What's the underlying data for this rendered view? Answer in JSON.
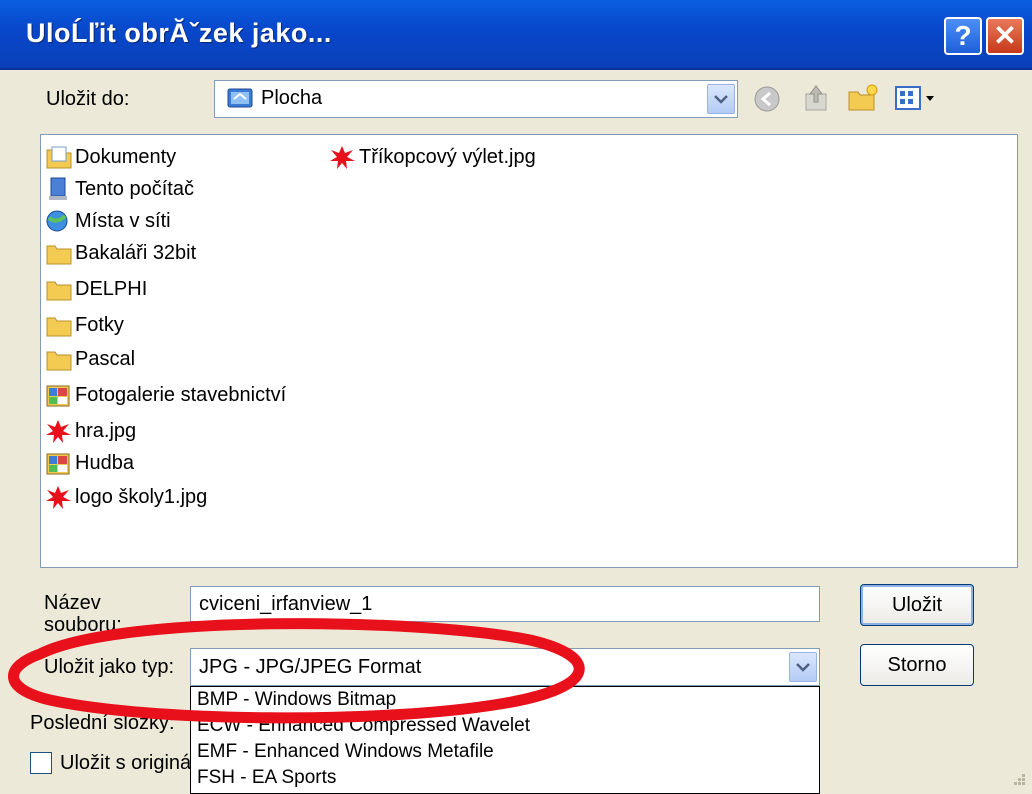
{
  "window": {
    "title": "UloĹľit obrĂˇzek jako...",
    "help_symbol": "?",
    "close_symbol": "✕"
  },
  "save_in": {
    "label": "Uložit do:",
    "value": "Plocha",
    "folder_icon": "desktop-icon"
  },
  "files": [
    {
      "name": "Dokumenty",
      "icon": "documents-folder-icon"
    },
    {
      "name": "Tento počítač",
      "icon": "my-computer-icon"
    },
    {
      "name": "Místa v síti",
      "icon": "network-places-icon"
    },
    {
      "name": "Bakaláři 32bit",
      "icon": "folder-icon"
    },
    {
      "name": "DELPHI",
      "icon": "folder-icon"
    },
    {
      "name": "Fotky",
      "icon": "folder-icon"
    },
    {
      "name": "Pascal",
      "icon": "folder-icon"
    },
    {
      "name": "Fotogalerie stavebnictví",
      "icon": "shortcut-icon"
    },
    {
      "name": "hra.jpg",
      "icon": "irfanview-image-icon"
    },
    {
      "name": "Hudba",
      "icon": "shortcut-icon"
    },
    {
      "name": "logo školy1.jpg",
      "icon": "irfanview-image-icon"
    },
    {
      "name": "Tříkopcový výlet.jpg",
      "icon": "irfanview-image-icon"
    }
  ],
  "filename": {
    "label": "Název souboru:",
    "value": "cviceni_irfanview_1"
  },
  "filetype": {
    "label": "Uložit jako typ:",
    "value": "JPG - JPG/JPEG Format",
    "options": [
      "BMP - Windows Bitmap",
      "ECW - Enhanced Compressed Wavelet",
      "EMF - Enhanced Windows Metafile",
      "FSH - EA Sports"
    ]
  },
  "recent_label": "Poslední složky:",
  "checkbox_label": "Uložit s originál",
  "buttons": {
    "save": "Uložit",
    "cancel": "Storno"
  },
  "colors": {
    "titlebar": "#0a5fe0",
    "annotation_ellipse": "#e8101a",
    "selection": "#316ac5"
  }
}
